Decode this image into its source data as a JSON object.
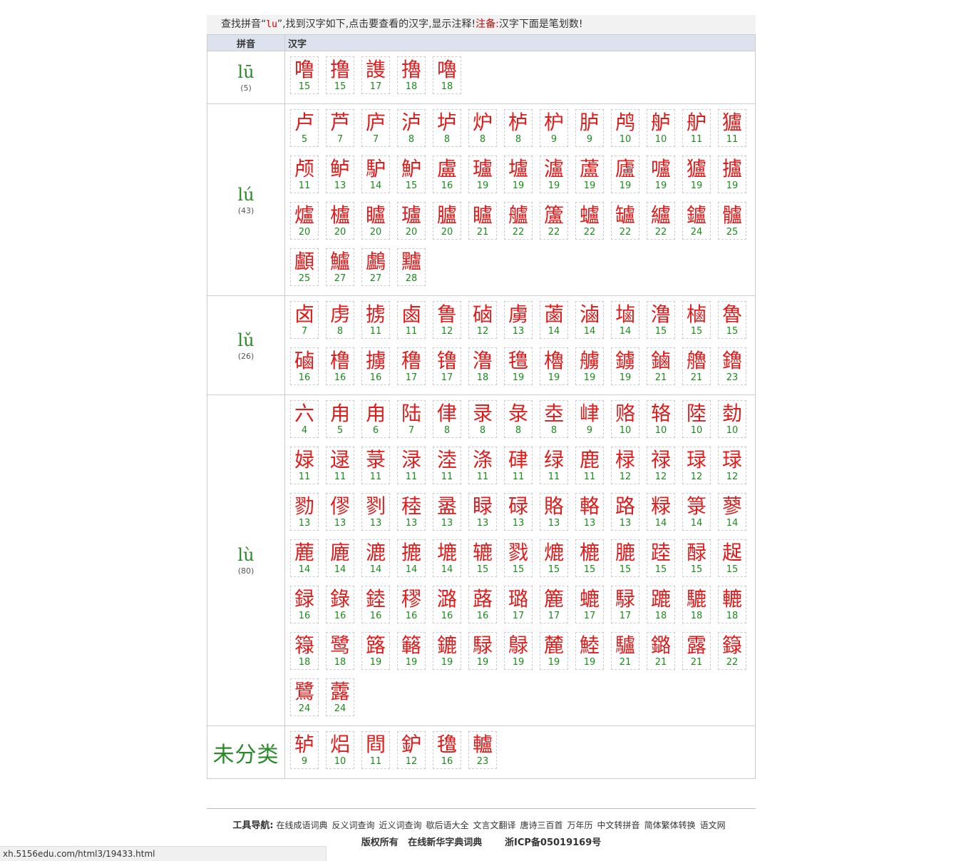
{
  "notice": {
    "prefix": "查找拼音“",
    "keyword": "lu",
    "suffix": "”,找到汉字如下,点击要查看的汉字,显示注释!",
    "note_label": "注备:",
    "note_text": "汉字下面是笔划数!"
  },
  "table": {
    "header_pinyin": "拼音",
    "header_hanzi": "汉字",
    "groups": [
      {
        "pinyin": "lū",
        "count": "(5)",
        "chars": [
          [
            "噜",
            "15"
          ],
          [
            "撸",
            "15"
          ],
          [
            "謢",
            "17"
          ],
          [
            "擼",
            "18"
          ],
          [
            "嚕",
            "18"
          ]
        ]
      },
      {
        "pinyin": "lú",
        "count": "(43)",
        "chars": [
          [
            "卢",
            "5"
          ],
          [
            "芦",
            "7"
          ],
          [
            "庐",
            "7"
          ],
          [
            "泸",
            "8"
          ],
          [
            "垆",
            "8"
          ],
          [
            "炉",
            "8"
          ],
          [
            "栌",
            "8"
          ],
          [
            "枦",
            "9"
          ],
          [
            "胪",
            "9"
          ],
          [
            "鸬",
            "10"
          ],
          [
            "舻",
            "10"
          ],
          [
            "舮",
            "11"
          ],
          [
            "獹",
            "11"
          ],
          [
            "颅",
            "11"
          ],
          [
            "鲈",
            "13"
          ],
          [
            "馿",
            "14"
          ],
          [
            "魲",
            "15"
          ],
          [
            "盧",
            "16"
          ],
          [
            "瓐",
            "19"
          ],
          [
            "壚",
            "19"
          ],
          [
            "瀘",
            "19"
          ],
          [
            "蘆",
            "19"
          ],
          [
            "廬",
            "19"
          ],
          [
            "嚧",
            "19"
          ],
          [
            "獹",
            "19"
          ],
          [
            "攎",
            "19"
          ],
          [
            "爐",
            "20"
          ],
          [
            "櫨",
            "20"
          ],
          [
            "矑",
            "20"
          ],
          [
            "瓐",
            "20"
          ],
          [
            "臚",
            "20"
          ],
          [
            "矑",
            "21"
          ],
          [
            "艫",
            "22"
          ],
          [
            "籚",
            "22"
          ],
          [
            "蠦",
            "22"
          ],
          [
            "罏",
            "22"
          ],
          [
            "纑",
            "22"
          ],
          [
            "鑪",
            "24"
          ],
          [
            "髗",
            "25"
          ],
          [
            "顱",
            "25"
          ],
          [
            "鱸",
            "27"
          ],
          [
            "鸕",
            "27"
          ],
          [
            "黸",
            "28"
          ]
        ]
      },
      {
        "pinyin": "lǔ",
        "count": "(26)",
        "chars": [
          [
            "卤",
            "7"
          ],
          [
            "虏",
            "8"
          ],
          [
            "掳",
            "11"
          ],
          [
            "鹵",
            "11"
          ],
          [
            "鲁",
            "12"
          ],
          [
            "硵",
            "12"
          ],
          [
            "虜",
            "13"
          ],
          [
            "蓾",
            "14"
          ],
          [
            "滷",
            "14"
          ],
          [
            "塷",
            "14"
          ],
          [
            "澛",
            "15"
          ],
          [
            "樐",
            "15"
          ],
          [
            "魯",
            "15"
          ],
          [
            "磠",
            "16"
          ],
          [
            "橹",
            "16"
          ],
          [
            "擄",
            "16"
          ],
          [
            "穞",
            "17"
          ],
          [
            "镥",
            "17"
          ],
          [
            "澛",
            "18"
          ],
          [
            "氇",
            "19"
          ],
          [
            "櫓",
            "19"
          ],
          [
            "艣",
            "19"
          ],
          [
            "鐪",
            "19"
          ],
          [
            "鏀",
            "21"
          ],
          [
            "艪",
            "21"
          ],
          [
            "鑥",
            "23"
          ]
        ]
      },
      {
        "pinyin": "lù",
        "count": "(80)",
        "chars": [
          [
            "六",
            "4"
          ],
          [
            "甪",
            "5"
          ],
          [
            "甪",
            "6"
          ],
          [
            "陆",
            "7"
          ],
          [
            "侓",
            "8"
          ],
          [
            "录",
            "8"
          ],
          [
            "彔",
            "8"
          ],
          [
            "坴",
            "8"
          ],
          [
            "峍",
            "9"
          ],
          [
            "赂",
            "10"
          ],
          [
            "辂",
            "10"
          ],
          [
            "陸",
            "10"
          ],
          [
            "勎",
            "10"
          ],
          [
            "娽",
            "11"
          ],
          [
            "逯",
            "11"
          ],
          [
            "菉",
            "11"
          ],
          [
            "渌",
            "11"
          ],
          [
            "淕",
            "11"
          ],
          [
            "涤",
            "11"
          ],
          [
            "硉",
            "11"
          ],
          [
            "绿",
            "11"
          ],
          [
            "鹿",
            "11"
          ],
          [
            "椂",
            "12"
          ],
          [
            "禄",
            "12"
          ],
          [
            "琭",
            "12"
          ],
          [
            "琭",
            "12"
          ],
          [
            "勠",
            "13"
          ],
          [
            "僇",
            "13"
          ],
          [
            "剹",
            "13"
          ],
          [
            "稑",
            "13"
          ],
          [
            "盝",
            "13"
          ],
          [
            "睩",
            "13"
          ],
          [
            "碌",
            "13"
          ],
          [
            "賂",
            "13"
          ],
          [
            "輅",
            "13"
          ],
          [
            "路",
            "13"
          ],
          [
            "粶",
            "14"
          ],
          [
            "箓",
            "14"
          ],
          [
            "蓼",
            "14"
          ],
          [
            "蔍",
            "14"
          ],
          [
            "廘",
            "14"
          ],
          [
            "漉",
            "14"
          ],
          [
            "摝",
            "14"
          ],
          [
            "塶",
            "14"
          ],
          [
            "辘",
            "15"
          ],
          [
            "戮",
            "15"
          ],
          [
            "熝",
            "15"
          ],
          [
            "樚",
            "15"
          ],
          [
            "膔",
            "15"
          ],
          [
            "踛",
            "15"
          ],
          [
            "醁",
            "15"
          ],
          [
            "趗",
            "15"
          ],
          [
            "録",
            "16"
          ],
          [
            "錄",
            "16"
          ],
          [
            "錴",
            "16"
          ],
          [
            "穋",
            "16"
          ],
          [
            "潞",
            "16"
          ],
          [
            "蕗",
            "16"
          ],
          [
            "璐",
            "17"
          ],
          [
            "簏",
            "17"
          ],
          [
            "螰",
            "17"
          ],
          [
            "騄",
            "17"
          ],
          [
            "蹗",
            "18"
          ],
          [
            "騼",
            "18"
          ],
          [
            "轆",
            "18"
          ],
          [
            "簶",
            "18"
          ],
          [
            "鹭",
            "18"
          ],
          [
            "簬",
            "19"
          ],
          [
            "簵",
            "19"
          ],
          [
            "鏕",
            "19"
          ],
          [
            "騄",
            "19"
          ],
          [
            "鵦",
            "19"
          ],
          [
            "麓",
            "19"
          ],
          [
            "鯥",
            "19"
          ],
          [
            "驢",
            "21"
          ],
          [
            "鏴",
            "21"
          ],
          [
            "露",
            "21"
          ],
          [
            "籙",
            "22"
          ],
          [
            "鷺",
            "24"
          ],
          [
            "虂",
            "24"
          ]
        ]
      },
      {
        "pinyin": "未分类",
        "count": "",
        "chars": [
          [
            "轳",
            "9"
          ],
          [
            "焒",
            "10"
          ],
          [
            "閰",
            "11"
          ],
          [
            "鈩",
            "12"
          ],
          [
            "氌",
            "16"
          ],
          [
            "轤",
            "23"
          ]
        ]
      }
    ]
  },
  "footer": {
    "nav_label": "工具导航:",
    "links": [
      "在线成语词典",
      "反义词查询",
      "近义词查询",
      "歇后语大全",
      "文言文翻译",
      "唐诗三百首",
      "万年历",
      "中文转拼音",
      "简体繁体转换",
      "语文网"
    ],
    "copyright": "版权所有   在线新华字典词典       浙ICP备05019169号"
  },
  "status_bar": "xh.5156edu.com/html3/19433.html"
}
